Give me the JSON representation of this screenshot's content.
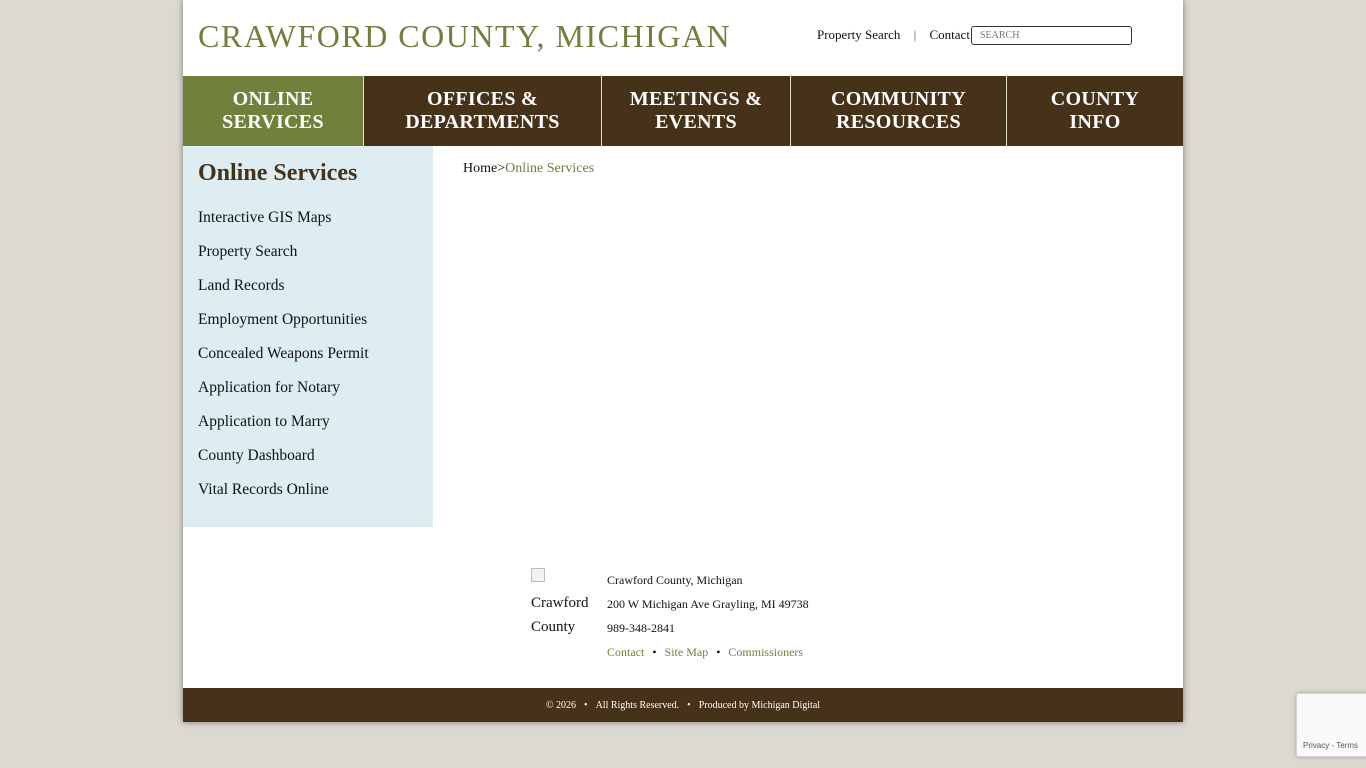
{
  "header": {
    "title": "CRAWFORD COUNTY, MICHIGAN",
    "utility_links": [
      "Property Search",
      "Contact"
    ],
    "separator": "|",
    "search_placeholder": "SEARCH"
  },
  "nav": {
    "items": [
      {
        "label": "ONLINE SERVICES",
        "line1": "ONLINE",
        "line2": "SERVICES",
        "active": true
      },
      {
        "label": "OFFICES & DEPARTMENTS",
        "line1": "OFFICES &",
        "line2": "DEPARTMENTS",
        "active": false
      },
      {
        "label": "MEETINGS & EVENTS",
        "line1": "MEETINGS &",
        "line2": "EVENTS",
        "active": false
      },
      {
        "label": "COMMUNITY RESOURCES",
        "line1": "COMMUNITY",
        "line2": "RESOURCES",
        "active": false
      },
      {
        "label": "COUNTY INFO",
        "line1": "COUNTY",
        "line2": "INFO",
        "active": false
      }
    ]
  },
  "sidebar": {
    "title": "Online Services",
    "items": [
      "Interactive GIS Maps",
      "Property Search",
      "Land Records",
      "Employment Opportunities",
      "Concealed Weapons Permit",
      "Application for Notary",
      "Application to Marry",
      "County Dashboard",
      "Vital Records Online"
    ]
  },
  "breadcrumb": {
    "home": "Home",
    "separator": ">",
    "current": "Online Services"
  },
  "footer": {
    "logo_alt": "Crawford County",
    "name": "Crawford County, Michigan",
    "address": "200 W Michigan Ave Grayling, MI 49738",
    "phone": "989-348-2841",
    "links": [
      "Contact",
      "Site Map",
      "Commissioners"
    ],
    "link_separator": "•"
  },
  "bottom_bar": {
    "copyright": "© 2026",
    "rights": "All Rights Reserved.",
    "produced_by": "Produced by Michigan Digital",
    "separator": "•"
  },
  "recaptcha": {
    "privacy": "Privacy",
    "terms": "Terms",
    "separator": "-"
  },
  "colors": {
    "brand_brown": "#463119",
    "brand_green": "#71803a",
    "sidebar_bg": "#ddedf1",
    "page_bg": "#dcd9d0"
  }
}
